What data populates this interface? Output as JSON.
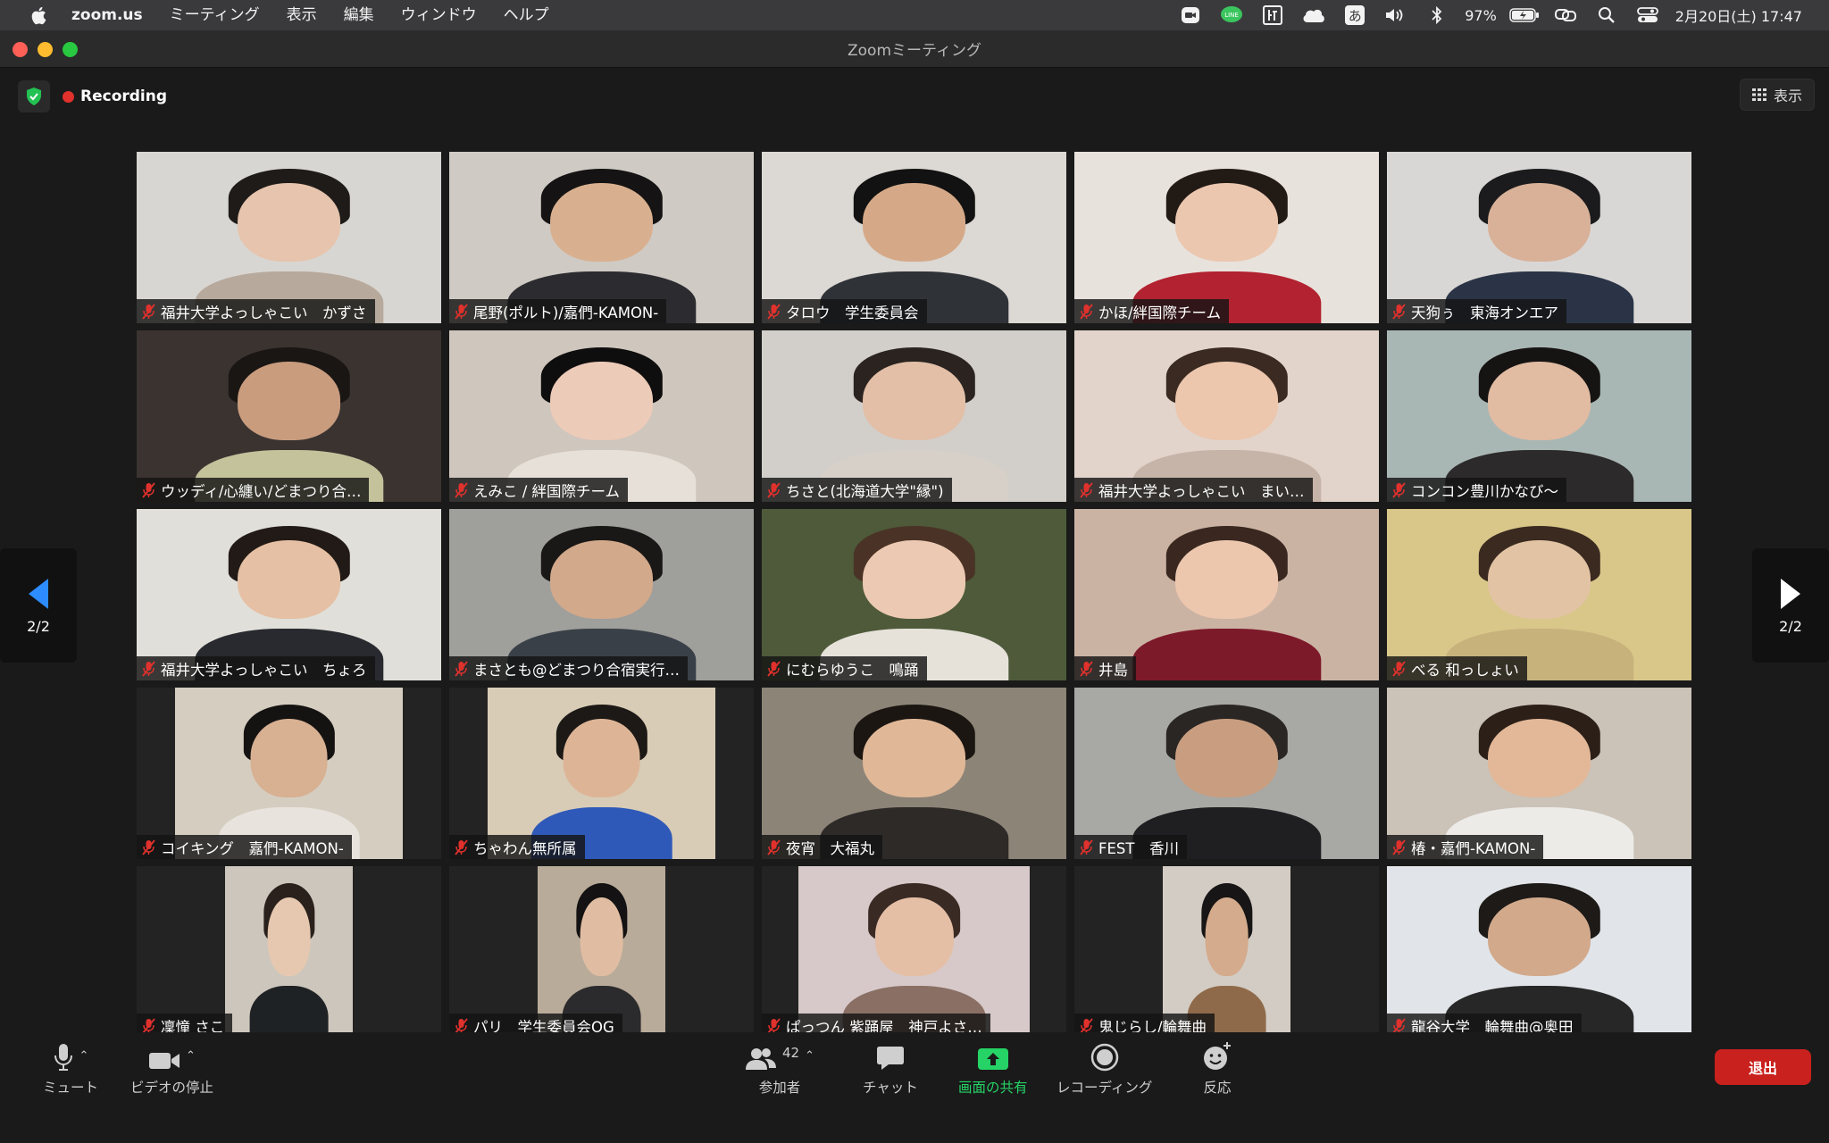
{
  "menubar": {
    "app": "zoom.us",
    "items": [
      "ミーティング",
      "表示",
      "編集",
      "ウィンドウ",
      "ヘルプ"
    ],
    "status_icons": [
      "zoom-video-icon",
      "line-icon",
      "japanese-calendar-icon",
      "cloud-icon",
      "input-method-icon",
      "volume-icon",
      "bluetooth-icon"
    ],
    "input_method": "あ",
    "battery": "97%",
    "datetime": "2月20日(土)  17:47"
  },
  "window": {
    "title": "Zoomミーティング"
  },
  "meeting": {
    "recording_label": "Recording",
    "view_label": "表示",
    "page_indicator_left": "2/2",
    "page_indicator_right": "2/2"
  },
  "participants": [
    {
      "name": "福井大学よっしゃこい　かずさ",
      "bg": "#d8d6d2",
      "skin": "#e6c4ad",
      "hair": "#1f1b19",
      "body": "#b7a99c"
    },
    {
      "name": "尾野(ポルト)/嘉們-KAMON-",
      "bg": "#cfcac4",
      "skin": "#d9b08f",
      "hair": "#151313",
      "body": "#2c2c30"
    },
    {
      "name": "タロウ　学生委員会",
      "bg": "#dcd8d3",
      "skin": "#d5a988",
      "hair": "#121212",
      "body": "#2f3338"
    },
    {
      "name": "かほ/絆国際チーム",
      "bg": "#e8e2dc",
      "skin": "#ecc7af",
      "hair": "#221a15",
      "body": "#b22230"
    },
    {
      "name": "天狗ぅ　東海オンエア",
      "bg": "#d9d7d5",
      "skin": "#d8b198",
      "hair": "#1b1b1d",
      "body": "#2a3446"
    },
    {
      "name": "ウッディ/心纏い/どまつり合…",
      "bg": "#3a3330",
      "skin": "#c99c7e",
      "hair": "#1a1614",
      "body": "#c4c29b"
    },
    {
      "name": "えみこ / 絆国際チーム",
      "bg": "#cfc6bd",
      "skin": "#eccbb8",
      "hair": "#0f0e0e",
      "body": "#e6e0d8"
    },
    {
      "name": "ちさと(北海道大学\"縁\")",
      "bg": "#d2cfcb",
      "skin": "#e2bfa6",
      "hair": "#2a2320",
      "body": "#d6d0c8"
    },
    {
      "name": "福井大学よっしゃこい　まい…",
      "bg": "#e2d4cb",
      "skin": "#ecc6ad",
      "hair": "#3a2a22",
      "body": "#c7b4a8"
    },
    {
      "name": "コンコン豊川かなび〜",
      "bg": "#a9b7b4",
      "skin": "#e1bba2",
      "hair": "#161413",
      "body": "#2c2a2a"
    },
    {
      "name": "福井大学よっしゃこい　ちょろ",
      "bg": "#e1dfd9",
      "skin": "#e5c0a4",
      "hair": "#221a16",
      "body": "#282a30"
    },
    {
      "name": "まさとも@どまつり合宿実行…",
      "bg": "#9f9f9b",
      "skin": "#d2a98b",
      "hair": "#1a1816",
      "body": "#3a4048"
    },
    {
      "name": "にむらゆうこ　鳴踊",
      "bg": "#4e5a3a",
      "skin": "#ecc9b2",
      "hair": "#4a3326",
      "body": "#e6e2da"
    },
    {
      "name": "井島",
      "bg": "#cbb3a3",
      "skin": "#ecc7ae",
      "hair": "#3a2820",
      "body": "#7d1a2a"
    },
    {
      "name": "べる 和っしょい",
      "bg": "#d9c78a",
      "skin": "#e2c3a4",
      "hair": "#3a2a20",
      "body": "#c8b27c"
    },
    {
      "name": "コイキング　嘉們-KAMON-",
      "bg": "#d5cdc0",
      "skin": "#d8b092",
      "hair": "#151312",
      "body": "#e8e4dd"
    },
    {
      "name": "ちゃわん無所属",
      "bg": "#d8ccb6",
      "skin": "#ddb596",
      "hair": "#1c1916",
      "body": "#2f59b8"
    },
    {
      "name": "夜宵　大福丸",
      "bg": "#8c8477",
      "skin": "#e0b898",
      "hair": "#1c1612",
      "body": "#2d2a28"
    },
    {
      "name": "FEST　香川",
      "bg": "#a8a8a4",
      "skin": "#c99e80",
      "hair": "#2a2624",
      "body": "#1f1f22"
    },
    {
      "name": "椿・嘉們-KAMON-",
      "bg": "#cbc2b8",
      "skin": "#e2b898",
      "hair": "#2b1f18",
      "body": "#ecebe8"
    },
    {
      "name": "凜憧 さこ",
      "bg": "#cdc6bc",
      "skin": "#e6c8b0",
      "hair": "#2a211c",
      "body": "#1f2224"
    },
    {
      "name": "パリ　学生委員会OG",
      "bg": "#b9ab99",
      "skin": "#e0bda2",
      "hair": "#141212",
      "body": "#2b2b2d"
    },
    {
      "name": "ぱっつん 紫踊屋　神戸よさ…",
      "bg": "#d7c9c9",
      "skin": "#e4bfa6",
      "hair": "#3a2a24",
      "body": "#8a6f64"
    },
    {
      "name": "鬼じらし/輪舞曲",
      "bg": "#d3ccc4",
      "skin": "#d4ab8c",
      "hair": "#171515",
      "body": "#8f6a4a"
    },
    {
      "name": "龍谷大学　輪舞曲@奥田",
      "bg": "#e1e4e8",
      "skin": "#d2a98b",
      "hair": "#1d1a18",
      "body": "#272727"
    }
  ],
  "toolbar": {
    "mute": "ミュート",
    "stop_video": "ビデオの停止",
    "participants": "参加者",
    "participants_count": "42",
    "chat": "チャット",
    "share_screen": "画面の共有",
    "recording": "レコーディング",
    "reactions": "反応",
    "leave": "退出"
  }
}
